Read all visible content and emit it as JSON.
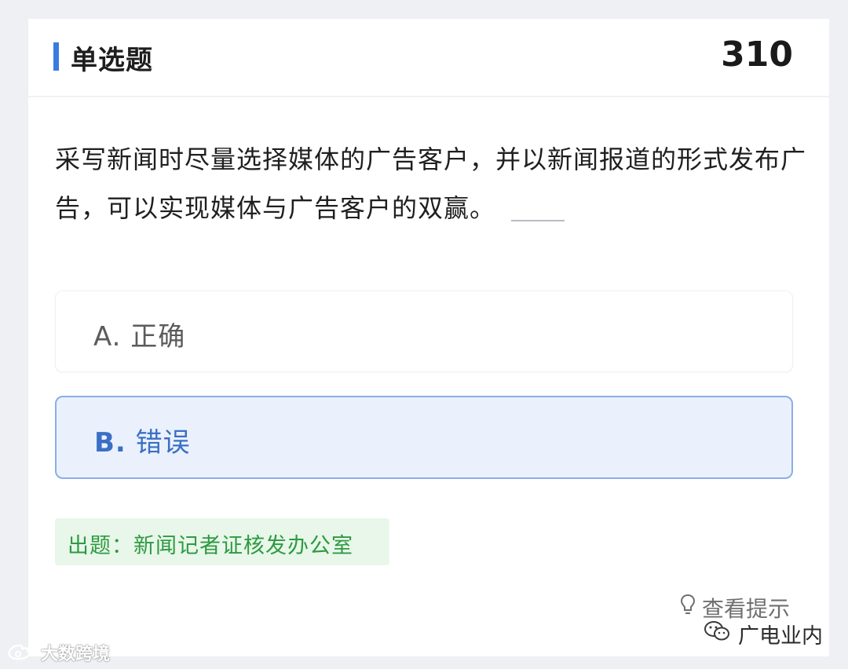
{
  "header": {
    "title": "单选题",
    "number": "310"
  },
  "question": {
    "text": "采写新闻时尽量选择媒体的广告客户，并以新闻报道的形式发布广告，可以实现媒体与广告客户的双赢。"
  },
  "options": [
    {
      "letter": "A.",
      "label": "正确",
      "selected": false
    },
    {
      "letter": "B.",
      "label": "错误",
      "selected": true
    }
  ],
  "source": {
    "text": "出题：新闻记者证核发办公室"
  },
  "hint": {
    "icon": "lightbulb-icon",
    "label": "查看提示"
  },
  "watermarks": {
    "right": {
      "icon": "wechat-icon",
      "text": "广电业内"
    },
    "left": {
      "icon": "weibo-icon",
      "text": "大数跨境"
    }
  },
  "colors": {
    "accent": "#3b7be0",
    "selected_bg": "#eaf1fd",
    "selected_border": "#8aaee6",
    "source_bg": "#e8f7ea",
    "source_text": "#2e9a41"
  }
}
